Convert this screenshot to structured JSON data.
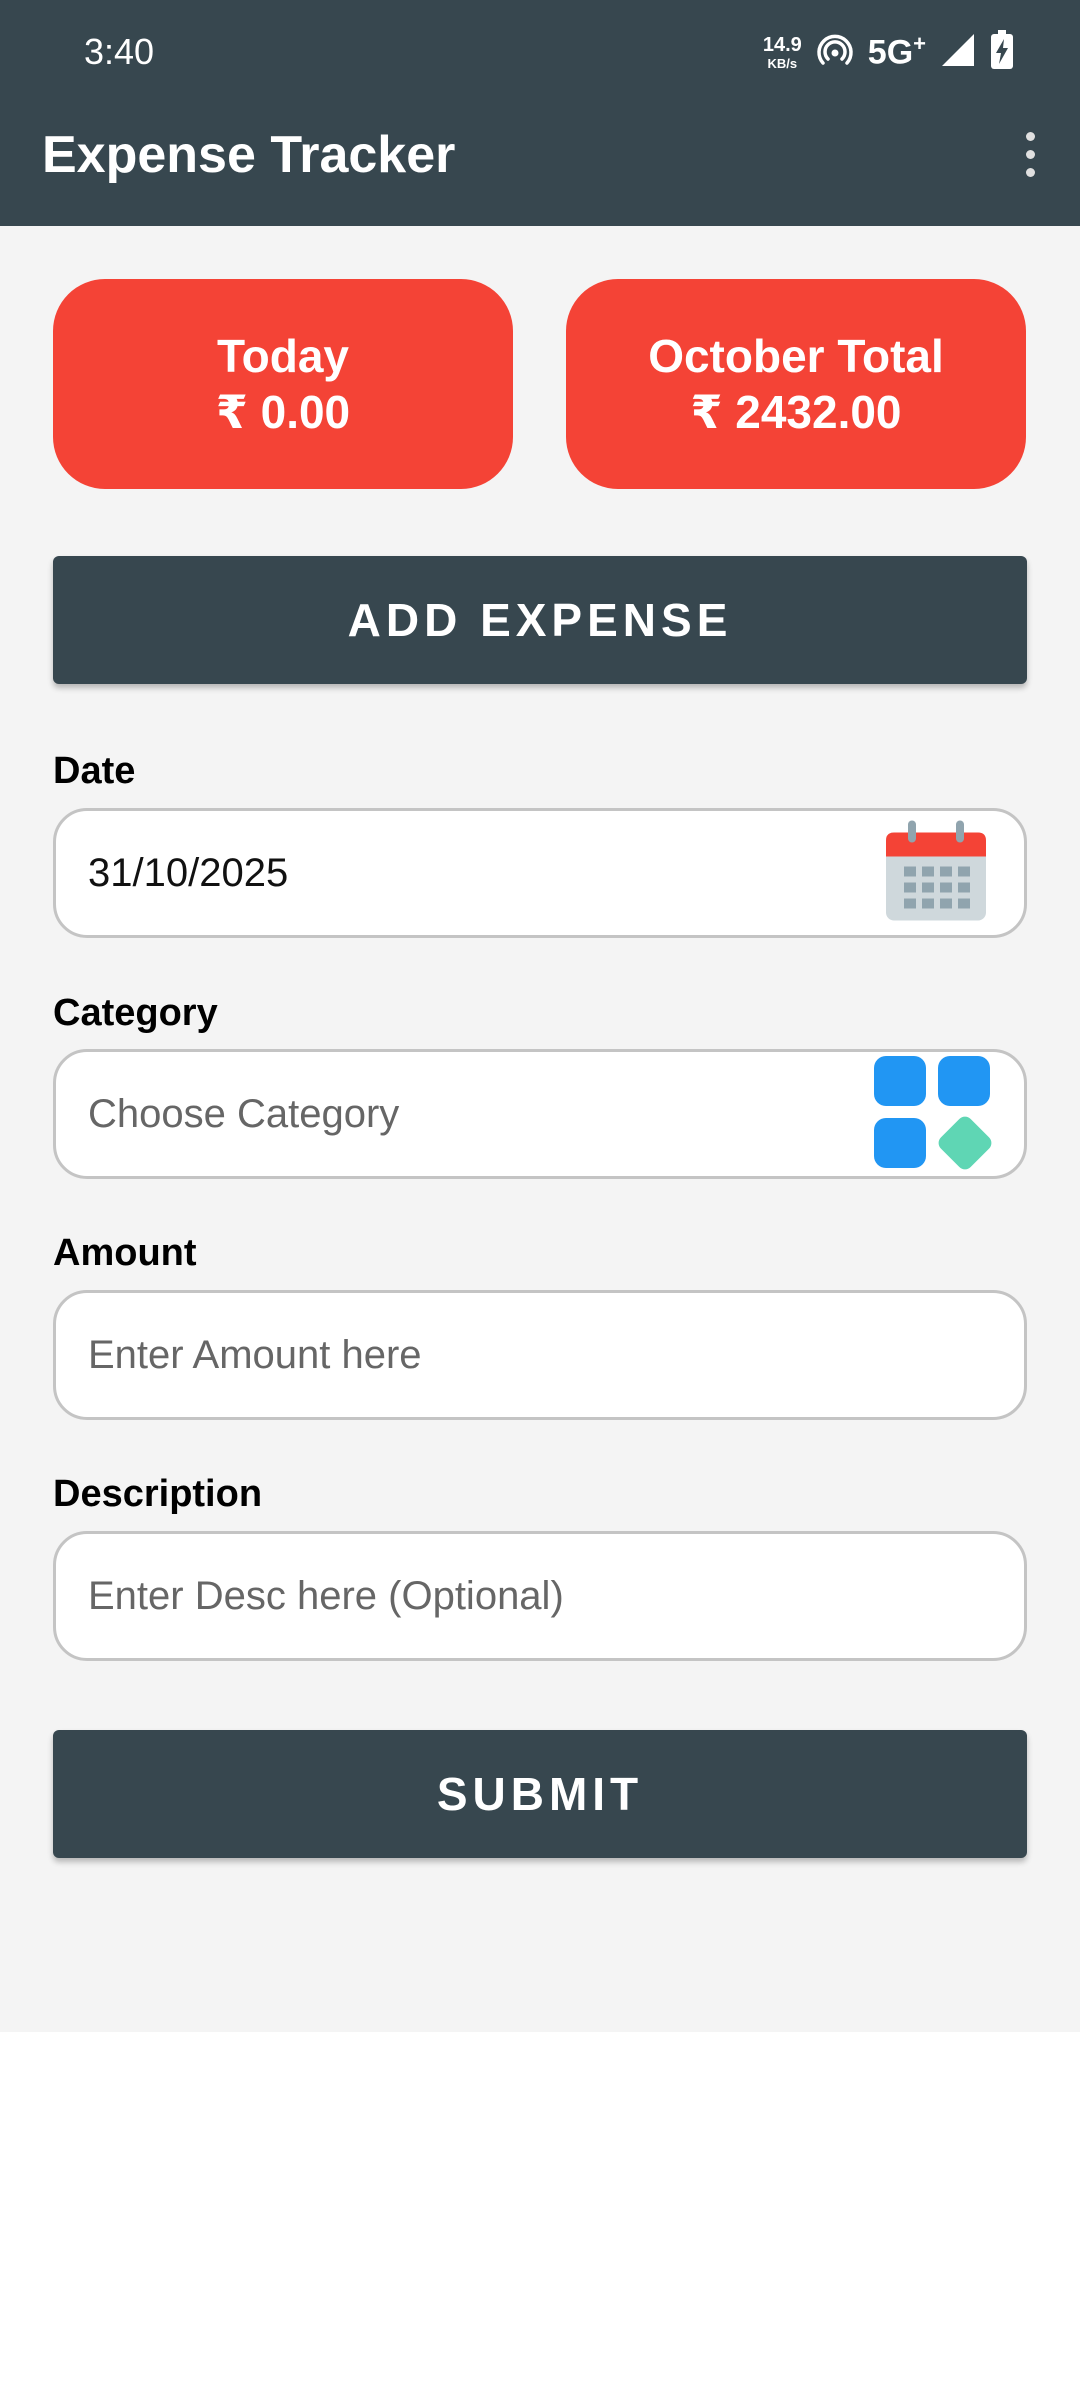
{
  "status_bar": {
    "time": "3:40",
    "net_speed_value": "14.9",
    "net_speed_unit": "KB/s",
    "network_label": "5G",
    "network_plus": "+",
    "icons": [
      "hotspot-icon",
      "signal-icon",
      "battery-charging-icon"
    ]
  },
  "app_bar": {
    "title": "Expense Tracker",
    "menu_icon": "more-vert-icon"
  },
  "summary": {
    "today_label": "Today",
    "today_value": "₹ 0.00",
    "month_label": "October Total",
    "month_value": "₹ 2432.00",
    "card_color": "#f44336"
  },
  "add_expense_label": "ADD EXPENSE",
  "form": {
    "date_label": "Date",
    "date_value": "31/10/2025",
    "date_icon": "calendar-icon",
    "category_label": "Category",
    "category_placeholder": "Choose Category",
    "category_icon": "category-grid-icon",
    "amount_label": "Amount",
    "amount_placeholder": "Enter Amount here",
    "description_label": "Description",
    "description_placeholder": "Enter Desc here (Optional)"
  },
  "submit_label": "SUBMIT",
  "colors": {
    "primary_dark": "#37474f",
    "accent_red": "#f44336",
    "background": "#f4f4f4"
  }
}
